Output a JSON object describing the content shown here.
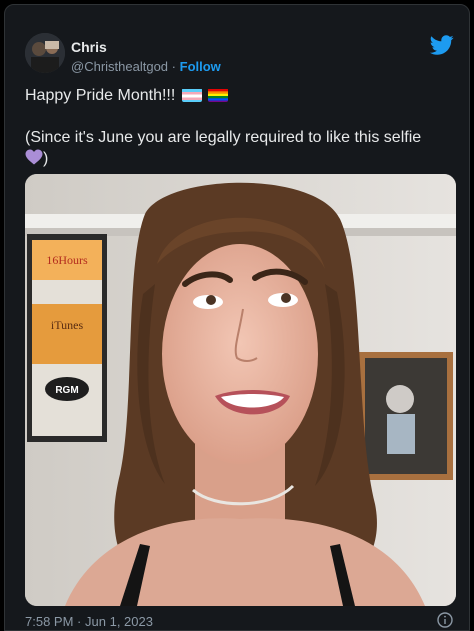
{
  "user": {
    "name": "Chris",
    "handle": "@Christhealtgod",
    "separator": "·",
    "follow_label": "Follow"
  },
  "tweet": {
    "line1": "Happy Pride Month!!! ",
    "line2": "(Since it's June you are legally required to like this selfie",
    "line2_end": ")"
  },
  "emojis": [
    "transgender-flag-icon",
    "rainbow-flag-icon",
    "purple-heart-icon"
  ],
  "photo": {
    "label": "selfie-photo",
    "poster_text_1": "16Hours",
    "poster_text_2": "iTunes",
    "poster_text_3": "RGM"
  },
  "meta": {
    "time": "7:58 PM",
    "separator": "·",
    "date": "Jun 1, 2023"
  },
  "colors": {
    "background": "#15181c",
    "text": "#e7e9ea",
    "muted": "#8b98a5",
    "accent": "#1d9bf0"
  }
}
